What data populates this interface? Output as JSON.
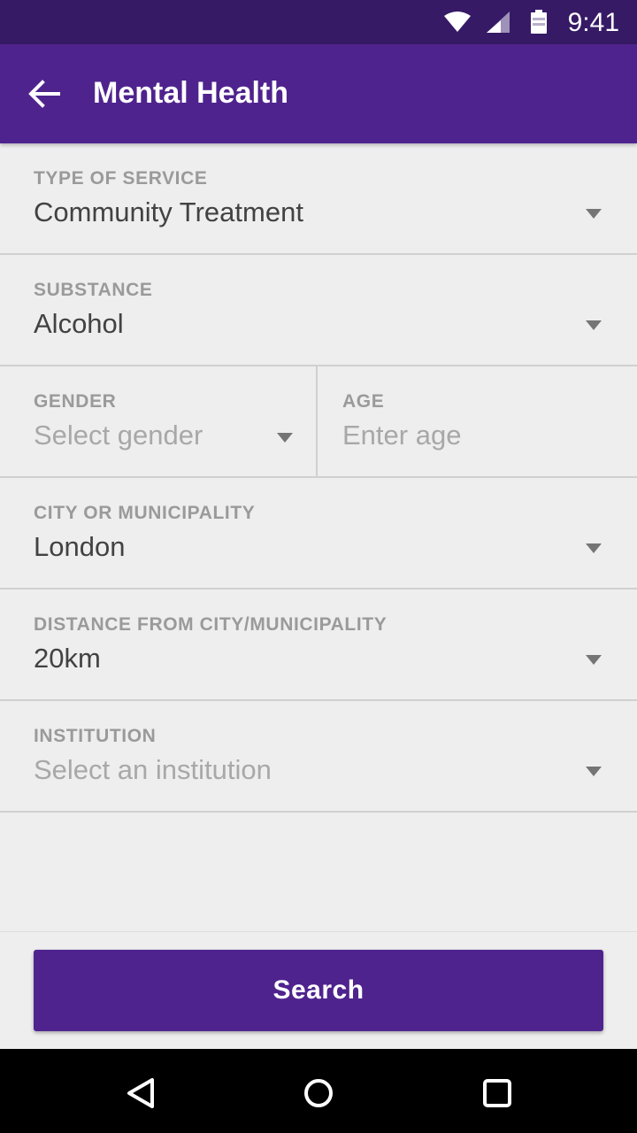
{
  "status_bar": {
    "time": "9:41",
    "icons": [
      "wifi-icon",
      "cell-signal-icon",
      "battery-icon"
    ]
  },
  "app_bar": {
    "back_icon": "arrow-back-icon",
    "title": "Mental Health"
  },
  "form": {
    "type_of_service": {
      "label": "TYPE OF SERVICE",
      "value": "Community Treatment"
    },
    "substance": {
      "label": "SUBSTANCE",
      "value": "Alcohol"
    },
    "gender": {
      "label": "GENDER",
      "placeholder": "Select gender"
    },
    "age": {
      "label": "AGE",
      "placeholder": "Enter age"
    },
    "city": {
      "label": "CITY OR MUNICIPALITY",
      "value": "London"
    },
    "distance": {
      "label": "DISTANCE FROM CITY/MUNICIPALITY",
      "value": "20km"
    },
    "institution": {
      "label": "INSTITUTION",
      "placeholder": "Select an institution"
    }
  },
  "search_button": {
    "label": "Search"
  },
  "nav_bar": {
    "icons": [
      "nav-back-icon",
      "nav-home-icon",
      "nav-recents-icon"
    ]
  },
  "colors": {
    "status_bar": "#361a66",
    "primary": "#4f238e",
    "background": "#eeeeee",
    "label": "#9a9a9a",
    "value_text": "#424242",
    "placeholder_text": "#a8a8a8"
  }
}
